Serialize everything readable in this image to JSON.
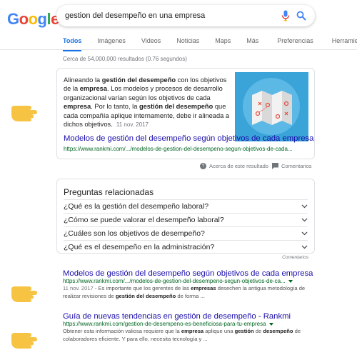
{
  "logo": {
    "letters": [
      "G",
      "o",
      "o",
      "g",
      "l",
      "e"
    ]
  },
  "search": {
    "query": "gestion del desempeño en una empresa"
  },
  "tabs": [
    {
      "label": "Todos",
      "active": true
    },
    {
      "label": "Imágenes",
      "active": false
    },
    {
      "label": "Videos",
      "active": false
    },
    {
      "label": "Noticias",
      "active": false
    },
    {
      "label": "Maps",
      "active": false
    },
    {
      "label": "Más",
      "active": false
    },
    {
      "label": "Preferencias",
      "active": false
    },
    {
      "label": "Herramientas",
      "active": false
    }
  ],
  "stats": "Cerca de 54,000,000 resultados (0.76 segundos)",
  "featured": {
    "snippet_parts": [
      {
        "t": "Alineando la ",
        "b": false
      },
      {
        "t": "gestión del desempeño",
        "b": true
      },
      {
        "t": " con los objetivos de la ",
        "b": false
      },
      {
        "t": "empresa",
        "b": true
      },
      {
        "t": ". Los modelos y procesos de desarrollo organizacional varían según los objetivos de cada ",
        "b": false
      },
      {
        "t": "empresa",
        "b": true
      },
      {
        "t": ". Por lo tanto, la ",
        "b": false
      },
      {
        "t": "gestión del desempeño",
        "b": true
      },
      {
        "t": " que cada compañía aplique internamente, debe ir alineada a dichos objetivos.",
        "b": false
      }
    ],
    "date": "11 nov. 2017",
    "title": "Modelos de gestión del desempeño según objetivos de cada empresa",
    "url": "https://www.rankmi.com/.../modelos-de-gestion-del-desempeno-segun-objetivos-de-cada..."
  },
  "feedback": {
    "about": "Acerca de este resultado",
    "comments": "Comentarios"
  },
  "paa": {
    "heading": "Preguntas relacionadas",
    "questions": [
      "¿Qué es la gestión del desempeño laboral?",
      "¿Cómo se puede valorar el desempeño laboral?",
      "¿Cuáles son los objetivos de desempeño?",
      "¿Qué es el desempeño en la administración?"
    ],
    "comments": "Comentarios"
  },
  "results": [
    {
      "title": "Modelos de gestión del desempeño según objetivos de cada empresa",
      "url": "https://www.rankmi.com/.../modelos-de-gestion-del-desempeno-segun-objetivos-de-ca...",
      "date": "11 nov. 2017",
      "snippet_a": " - Es importante que los gerentes de las ",
      "snippet_b": "empresas",
      "snippet_c": " desechen la antigua metodología de realizar revisiones de ",
      "snippet_d": "gestión del desempeño",
      "snippet_e": " de forma ..."
    },
    {
      "title": "Guía de nuevas tendencias en gestión de desempeño - Rankmi",
      "url": "https://www.rankmi.com/gestion-de-desempeno-es-beneficiosa-para-tu-empresa",
      "snippet_a": "Obtener esta información valiosa requiere que la ",
      "snippet_b": "empresa",
      "snippet_c": " aplique una ",
      "snippet_d": "gestión",
      "snippet_e": " de ",
      "snippet_f": "desempeño",
      "snippet_g": " de colaboradores eficiente. Y para ello, necesita tecnología y ..."
    }
  ],
  "colors": {
    "link": "#1a0dab",
    "url": "#006621",
    "accent": "#1a73e8",
    "hand": "#f6c343"
  },
  "icons": [
    "microphone-icon",
    "search-icon",
    "question-icon",
    "comment-icon",
    "chevron-down-icon",
    "pointing-hand-icon"
  ]
}
